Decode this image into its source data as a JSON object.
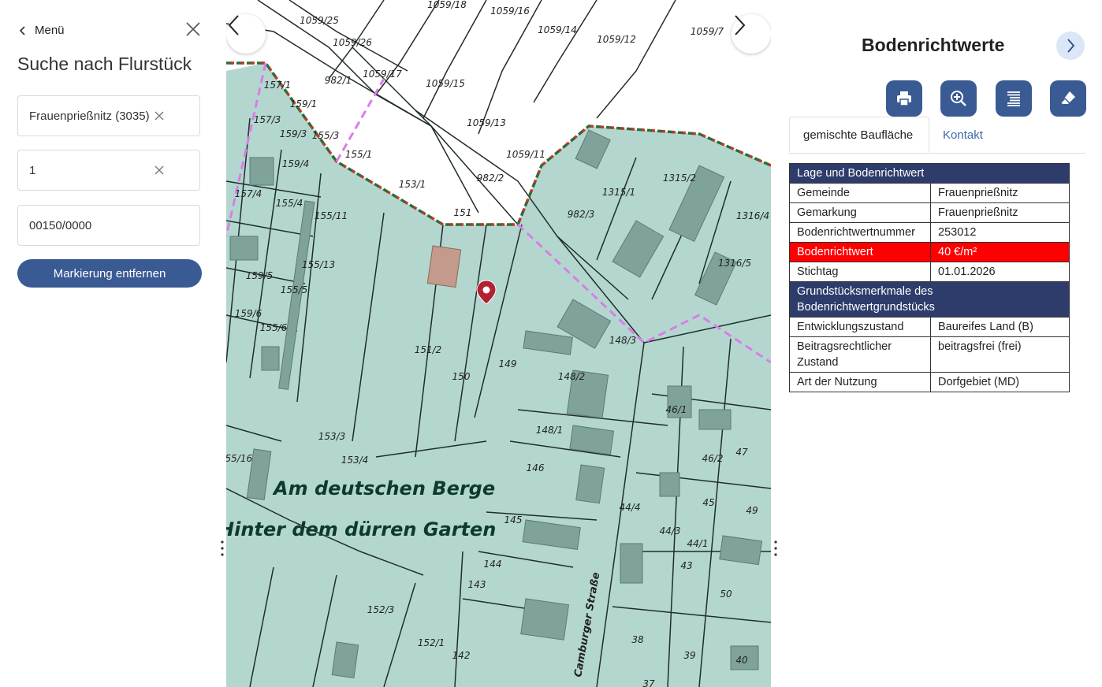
{
  "left_panel": {
    "menu_label": "Menü",
    "title": "Suche nach Flurstück",
    "fields": [
      {
        "value": "Frauenprießnitz (3035)",
        "clearable": true
      },
      {
        "value": "1",
        "clearable": true
      },
      {
        "value": "00150/0000",
        "clearable": false
      }
    ],
    "remove_button": "Markierung entfernen"
  },
  "map": {
    "parcels": [
      "1059/25",
      "1059/26",
      "1059/18",
      "1059/16",
      "1059/14",
      "1059/12",
      "1059/7",
      "1059/17",
      "1059/15",
      "1059/13",
      "1059/11",
      "157/1",
      "159/1",
      "982/1",
      "157/3",
      "159/3",
      "155/3",
      "155/1",
      "153/1",
      "151",
      "982/2",
      "159/4",
      "155/4",
      "155/11",
      "157/4",
      "155/13",
      "159/5",
      "155/5",
      "159/6",
      "155/6",
      "151/2",
      "150",
      "149",
      "148/3",
      "148/2",
      "148/1",
      "146",
      "153/3",
      "153/4",
      "155/16",
      "145",
      "144",
      "143",
      "142",
      "152/3",
      "152/1",
      "1315/1",
      "1315/2",
      "982/3",
      "1316/4",
      "1316/5",
      "46/1",
      "46/2",
      "47",
      "45",
      "49",
      "44/1",
      "43",
      "44/3",
      "50",
      "38",
      "39",
      "40",
      "44/4",
      "37"
    ],
    "place_names": [
      "Am deutschen Berge",
      "Hinter dem dürren Garten"
    ],
    "street": "Camburger Straße"
  },
  "right_panel": {
    "title": "Bodenrichtwerte",
    "tools": [
      "print-icon",
      "zoom-in-icon",
      "list-icon",
      "eraser-icon"
    ],
    "tabs": [
      "gemischte Baufläche",
      "Kontakt"
    ],
    "section1": "Lage und Bodenrichtwert",
    "rows1": [
      {
        "k": "Gemeinde",
        "v": "Frauenprießnitz"
      },
      {
        "k": "Gemarkung",
        "v": "Frauenprießnitz"
      },
      {
        "k": "Bodenrichtwertnummer",
        "v": "253012"
      },
      {
        "k": "Bodenrichtwert",
        "v": "40 €/m²"
      },
      {
        "k": "Stichtag",
        "v": "01.01.2026"
      }
    ],
    "section2": "Grundstücksmerkmale des Bodenrichtwertgrundstücks",
    "rows2": [
      {
        "k": "Entwicklungszustand",
        "v": "Baureifes Land (B)"
      },
      {
        "k": "Beitragsrechtlicher Zustand",
        "v": "beitragsfrei (frei)"
      },
      {
        "k": "Art der Nutzung",
        "v": "Dorfgebiet (MD)"
      }
    ]
  },
  "colors": {
    "accent": "#3a5a93",
    "highlight": "#ff0000",
    "table_header": "#2e3c6b",
    "map_area": "#b3d7cf",
    "marker": "#b22232"
  }
}
